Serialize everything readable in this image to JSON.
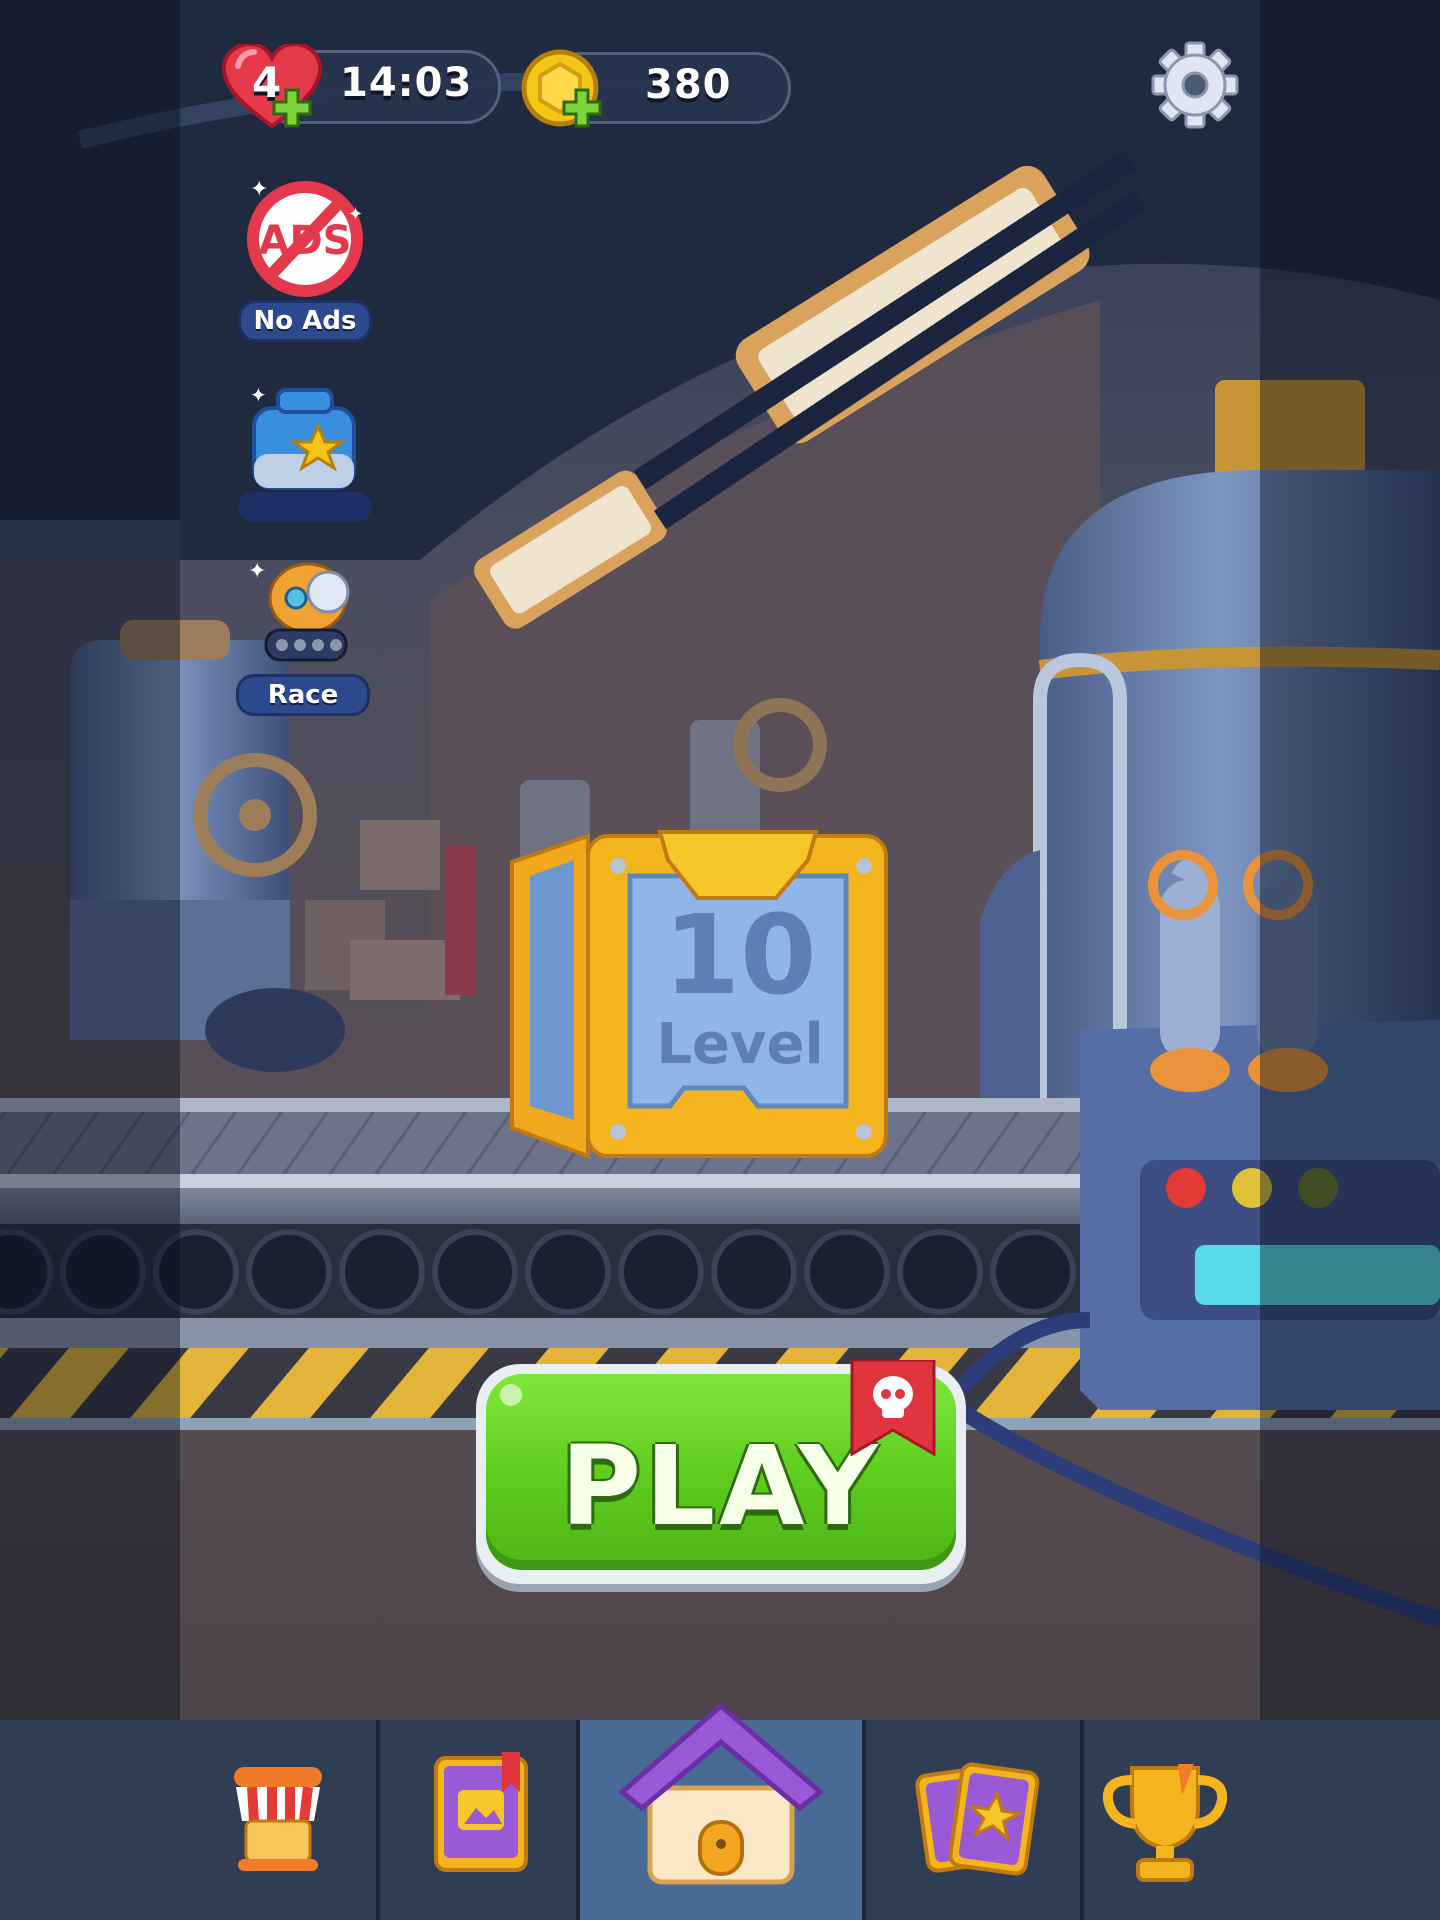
{
  "hud": {
    "lives_count": "4",
    "lives_timer": "14:03",
    "coins": "380"
  },
  "side_buttons": {
    "no_ads_label": "No Ads",
    "chest_label": "",
    "race_label": "Race"
  },
  "level": {
    "number": "10",
    "word": "Level"
  },
  "play": {
    "label": "PLAY"
  },
  "nav": {
    "active_tab": "home",
    "tabs": [
      "shop",
      "album",
      "home",
      "cards",
      "leaderboard"
    ]
  },
  "colors": {
    "play_green": "#5ccb1c",
    "hud_pill": "#26344e",
    "nav_bg": "#2f3d55",
    "nav_active": "#4a6a96",
    "crate_gold": "#f4b41e",
    "crate_blue": "#8fb6e6",
    "heart_red": "#e53a4a",
    "coin_gold": "#f5c518"
  }
}
